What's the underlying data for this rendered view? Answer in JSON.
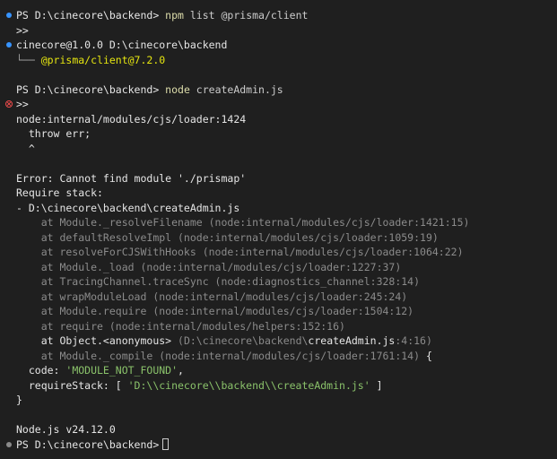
{
  "terminal": {
    "lines": [
      {
        "type": "prompt",
        "marker": "dot-blue",
        "prompt": "PS D:\\cinecore\\backend> ",
        "cmd": "npm",
        "args": " list @prisma/client"
      },
      {
        "type": "text",
        "marker": "",
        "parts": [
          {
            "t": ">>",
            "c": "white"
          }
        ]
      },
      {
        "type": "text",
        "marker": "dot-blue",
        "parts": [
          {
            "t": "cinecore@1.0.0 D:\\cinecore\\backend",
            "c": "white"
          }
        ]
      },
      {
        "type": "text",
        "marker": "",
        "parts": [
          {
            "t": "└── ",
            "c": "tree"
          },
          {
            "t": "@prisma/client@7.2.0",
            "c": "yellow"
          }
        ]
      },
      {
        "type": "blank"
      },
      {
        "type": "prompt",
        "marker": "",
        "prompt": "PS D:\\cinecore\\backend> ",
        "cmd": "node",
        "args": " createAdmin.js"
      },
      {
        "type": "text",
        "marker": "error",
        "parts": [
          {
            "t": ">>",
            "c": "white"
          }
        ]
      },
      {
        "type": "text",
        "marker": "",
        "parts": [
          {
            "t": "node:internal/modules/cjs/loader:1424",
            "c": "white"
          }
        ]
      },
      {
        "type": "text",
        "marker": "",
        "parts": [
          {
            "t": "  throw err;",
            "c": "white"
          }
        ]
      },
      {
        "type": "text",
        "marker": "",
        "parts": [
          {
            "t": "  ^",
            "c": "white"
          }
        ]
      },
      {
        "type": "blank"
      },
      {
        "type": "text",
        "marker": "",
        "parts": [
          {
            "t": "Error: Cannot find module './prismap'",
            "c": "white"
          }
        ]
      },
      {
        "type": "text",
        "marker": "",
        "parts": [
          {
            "t": "Require stack:",
            "c": "white"
          }
        ]
      },
      {
        "type": "text",
        "marker": "",
        "parts": [
          {
            "t": "- D:\\cinecore\\backend\\createAdmin.js",
            "c": "white"
          }
        ]
      },
      {
        "type": "text",
        "marker": "",
        "parts": [
          {
            "t": "    at Module._resolveFilename (node:internal/modules/cjs/loader:1421:15)",
            "c": "dim"
          }
        ]
      },
      {
        "type": "text",
        "marker": "",
        "parts": [
          {
            "t": "    at defaultResolveImpl (node:internal/modules/cjs/loader:1059:19)",
            "c": "dim"
          }
        ]
      },
      {
        "type": "text",
        "marker": "",
        "parts": [
          {
            "t": "    at resolveForCJSWithHooks (node:internal/modules/cjs/loader:1064:22)",
            "c": "dim"
          }
        ]
      },
      {
        "type": "text",
        "marker": "",
        "parts": [
          {
            "t": "    at Module._load (node:internal/modules/cjs/loader:1227:37)",
            "c": "dim"
          }
        ]
      },
      {
        "type": "text",
        "marker": "",
        "parts": [
          {
            "t": "    at TracingChannel.traceSync (node:diagnostics_channel:328:14)",
            "c": "dim"
          }
        ]
      },
      {
        "type": "text",
        "marker": "",
        "parts": [
          {
            "t": "    at wrapModuleLoad (node:internal/modules/cjs/loader:245:24)",
            "c": "dim"
          }
        ]
      },
      {
        "type": "text",
        "marker": "",
        "parts": [
          {
            "t": "    at Module.require (node:internal/modules/cjs/loader:1504:12)",
            "c": "dim"
          }
        ]
      },
      {
        "type": "text",
        "marker": "",
        "parts": [
          {
            "t": "    at require (node:internal/modules/helpers:152:16)",
            "c": "dim"
          }
        ]
      },
      {
        "type": "text",
        "marker": "",
        "parts": [
          {
            "t": "    at Object.<anonymous> ",
            "c": "white"
          },
          {
            "t": "(D:\\cinecore\\backend\\",
            "c": "dim"
          },
          {
            "t": "createAdmin.js",
            "c": "white"
          },
          {
            "t": ":4:16)",
            "c": "dim"
          }
        ]
      },
      {
        "type": "text",
        "marker": "",
        "parts": [
          {
            "t": "    at Module._compile (node:internal/modules/cjs/loader:1761:14) ",
            "c": "dim"
          },
          {
            "t": "{",
            "c": "white"
          }
        ]
      },
      {
        "type": "text",
        "marker": "",
        "parts": [
          {
            "t": "  code: ",
            "c": "white"
          },
          {
            "t": "'MODULE_NOT_FOUND'",
            "c": "green2"
          },
          {
            "t": ",",
            "c": "white"
          }
        ]
      },
      {
        "type": "text",
        "marker": "",
        "parts": [
          {
            "t": "  requireStack: [ ",
            "c": "white"
          },
          {
            "t": "'D:\\\\cinecore\\\\backend\\\\createAdmin.js'",
            "c": "green2"
          },
          {
            "t": " ]",
            "c": "white"
          }
        ]
      },
      {
        "type": "text",
        "marker": "",
        "parts": [
          {
            "t": "}",
            "c": "white"
          }
        ]
      },
      {
        "type": "blank"
      },
      {
        "type": "text",
        "marker": "",
        "parts": [
          {
            "t": "Node.js v24.12.0",
            "c": "white"
          }
        ]
      },
      {
        "type": "prompt-cursor",
        "marker": "dot-gray",
        "prompt": "PS D:\\cinecore\\backend>"
      }
    ]
  },
  "colors": {
    "background": "#1f1f1f",
    "command": "#dcdcaa",
    "package": "#e5e510",
    "string": "#8ac26a",
    "dim": "#8b8b8b",
    "error": "#f14c4c",
    "marker_blue": "#3794ff"
  }
}
